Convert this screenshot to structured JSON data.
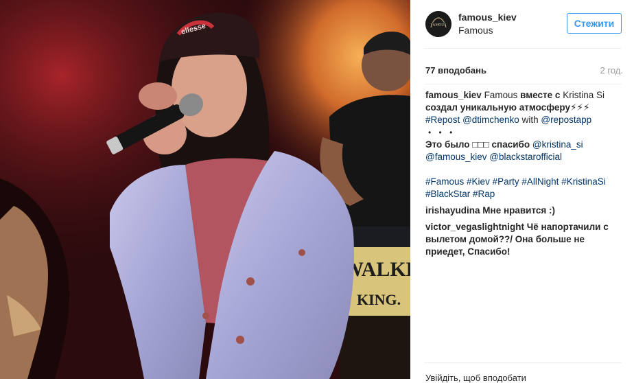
{
  "post": {
    "username": "famous_kiev",
    "location": "Famous",
    "follow_label": "Стежити",
    "likes": "77 вподобань",
    "time": "2 год."
  },
  "caption": {
    "user": "famous_kiev",
    "line1_a": "Famous",
    "line1_b": "вместе с",
    "line1_c": "Kristina Si",
    "line2_a": "создал уникальную атмосферу⚡⚡⚡",
    "line2_b": "#Repost",
    "mention1": "@dtimchenko",
    "with": "with",
    "mention2": "@repostapp",
    "dots": "• • •",
    "line4_a": "Это было",
    "line4_emoji": "□□□",
    "line4_b": "спасибо",
    "mention3": "@kristina_si",
    "mention4": "@famous_kiev",
    "mention5": "@blackstarofficial",
    "hashtags": [
      "#Famous",
      "#Kiev",
      "#Party",
      "#AllNight",
      "#KristinaSi",
      "#BlackStar",
      "#Rap"
    ]
  },
  "comments": [
    {
      "user": "irishayudina",
      "text": "Мне нравится :)"
    },
    {
      "user": "victor_vegaslightnight",
      "text": "Чё напортачили с вылетом домой??/ Она больше не приедет, Спасибо!"
    }
  ],
  "footer": {
    "partial": "Увійдіть, щоб вподобати"
  },
  "photo": {
    "cap_text": "ellesse",
    "sign_text_1": "WALKE",
    "sign_text_2": "KING."
  },
  "colors": {
    "accent": "#3897f0",
    "link": "#003569",
    "muted": "#999999"
  }
}
